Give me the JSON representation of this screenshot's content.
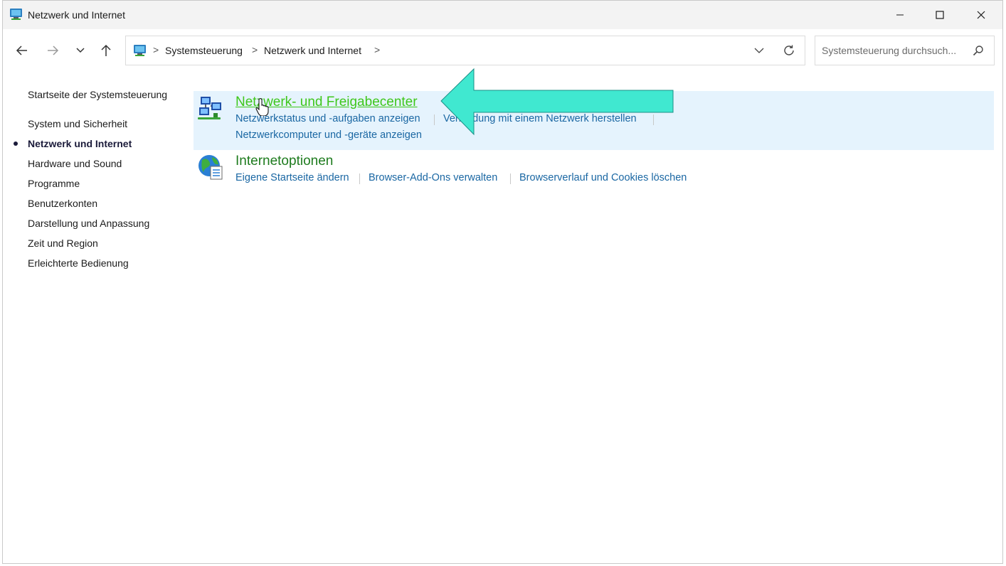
{
  "window": {
    "title": "Netzwerk und Internet",
    "colors": {
      "titlebar_bg": "#f3f3f3",
      "highlight_bg": "#e5f3fd",
      "category_green": "#1e7b1e",
      "link_blue": "#1a67a3",
      "annotation_arrow": "#40e8d0"
    }
  },
  "titlebar_buttons": {
    "minimize": "minimize-icon",
    "maximize": "maximize-icon",
    "close": "close-icon"
  },
  "nav": {
    "back": "arrow-left-icon",
    "forward": "arrow-right-icon",
    "recent": "chevron-down-icon",
    "up": "arrow-up-icon"
  },
  "address": {
    "crumbs": [
      "Systemsteuerung",
      "Netzwerk und Internet"
    ],
    "separator": ">"
  },
  "search": {
    "placeholder": "Systemsteuerung durchsuch...",
    "value": ""
  },
  "sidebar": {
    "home": "Startseite der Systemsteuerung",
    "items": [
      {
        "label": "System und Sicherheit",
        "active": false
      },
      {
        "label": "Netzwerk und Internet",
        "active": true
      },
      {
        "label": "Hardware und Sound",
        "active": false
      },
      {
        "label": "Programme",
        "active": false
      },
      {
        "label": "Benutzerkonten",
        "active": false
      },
      {
        "label": "Darstellung und Anpassung",
        "active": false
      },
      {
        "label": "Zeit und Region",
        "active": false
      },
      {
        "label": "Erleichterte Bedienung",
        "active": false
      }
    ]
  },
  "categories": [
    {
      "title": "Netzwerk- und Freigabecenter",
      "icon": "network-sharing-center-icon",
      "tasks": [
        "Netzwerkstatus und -aufgaben anzeigen",
        "Verbindung mit einem Netzwerk herstellen",
        "Netzwerkcomputer und -geräte anzeigen"
      ]
    },
    {
      "title": "Internetoptionen",
      "icon": "internet-options-globe-icon",
      "tasks": [
        "Eigene Startseite ändern",
        "Browser-Add-Ons verwalten",
        "Browserverlauf und Cookies löschen"
      ]
    }
  ]
}
